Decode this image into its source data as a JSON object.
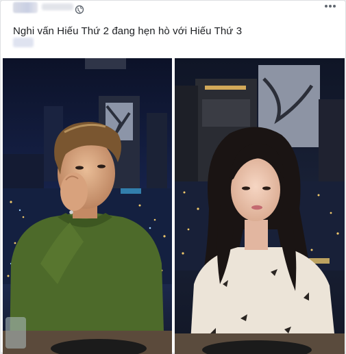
{
  "post": {
    "caption": "Nghi vấn Hiếu Thứ 2 đang hẹn hò với Hiếu Thứ 3",
    "privacy_icon": "globe-icon",
    "menu_icon": "more-options-icon"
  },
  "photos": [
    {
      "name": "photo-man-dinner"
    },
    {
      "name": "photo-woman-dinner"
    }
  ],
  "colors": {
    "text": "#1c1e21",
    "card_border": "#dddfe2",
    "night_sky": "#101833",
    "sweater_green": "#4d6a2a",
    "blouse_cream": "#ece4d8"
  }
}
